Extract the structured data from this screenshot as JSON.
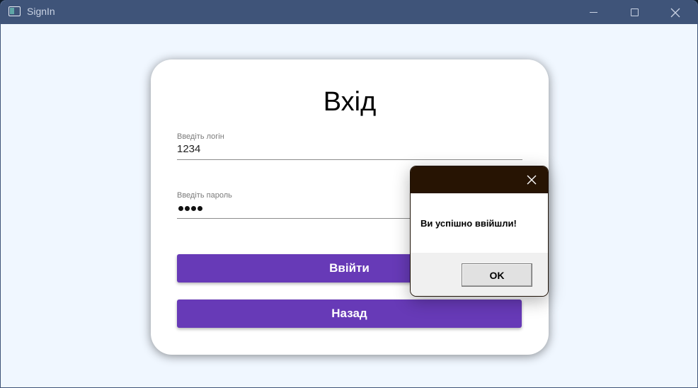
{
  "window": {
    "title": "SignIn",
    "icon": "app-window-icon",
    "controls": {
      "minimize": "minimize-icon",
      "maximize": "maximize-icon",
      "close": "close-icon"
    }
  },
  "form": {
    "heading": "Вхід",
    "login": {
      "label": "Введіть логін",
      "value": "1234"
    },
    "password": {
      "label": "Введіть пароль",
      "masked_length": 4
    },
    "login_button": "Ввійти",
    "back_button": "Назад"
  },
  "dialog": {
    "message": "Ви успішно ввійшли!",
    "ok_label": "OK",
    "close_icon": "close-icon"
  },
  "colors": {
    "titlebar": "#3f5479",
    "window_background": "#f0f7ff",
    "button_accent": "#673ab7",
    "dialog_titlebar": "#271403"
  }
}
